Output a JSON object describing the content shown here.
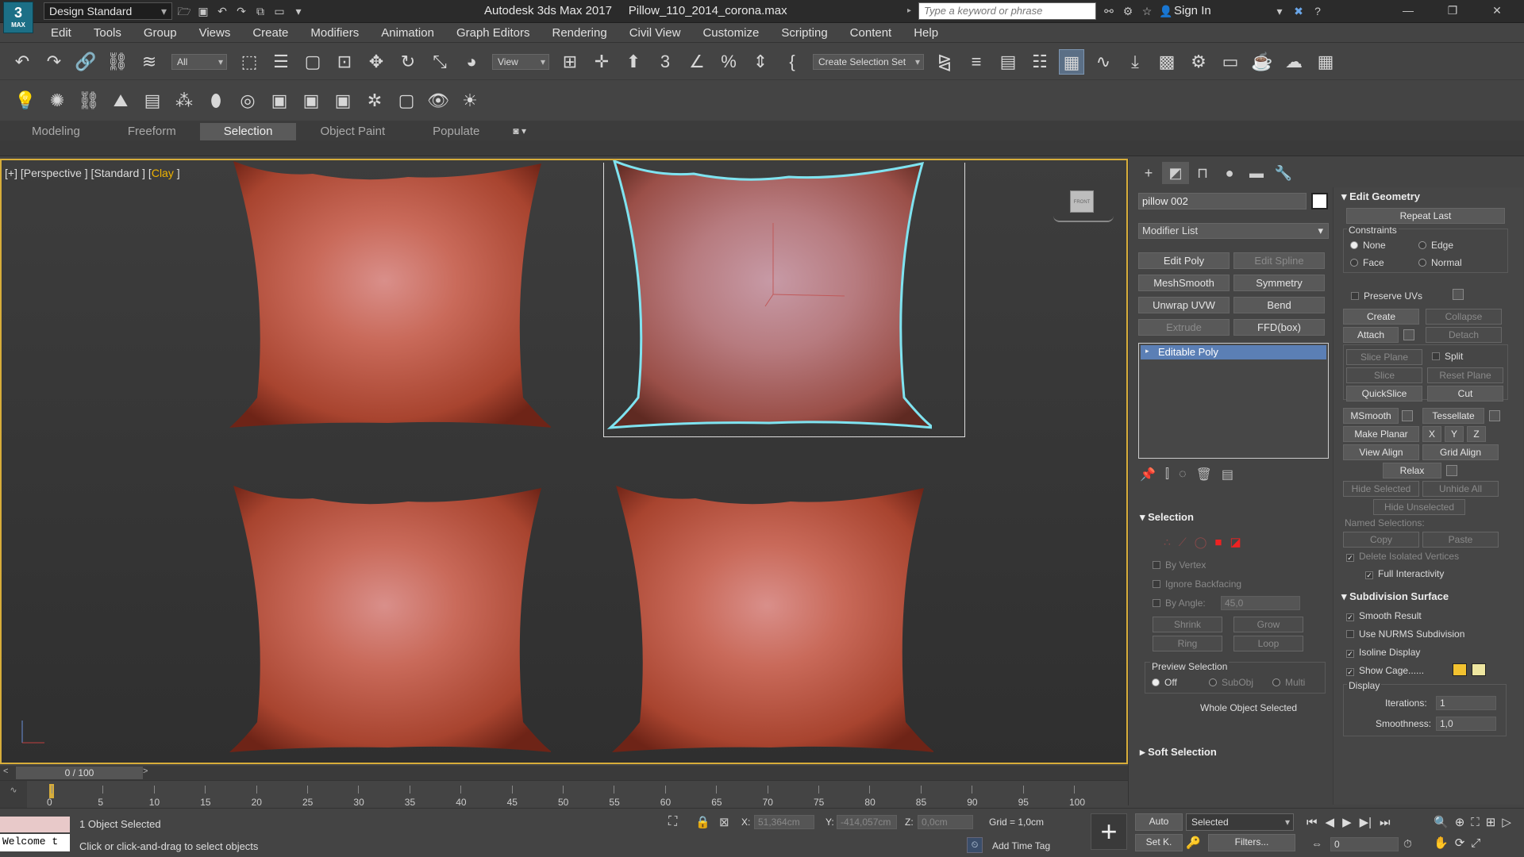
{
  "app": {
    "logo_text": "3",
    "logo_sub": "MAX",
    "workspace": "Design Standard",
    "title": "Autodesk 3ds Max 2017     Pillow_110_2014_corona.max",
    "search_placeholder": "Type a keyword or phrase",
    "sign_in": "Sign In"
  },
  "menu": [
    "Edit",
    "Tools",
    "Group",
    "Views",
    "Create",
    "Modifiers",
    "Animation",
    "Graph Editors",
    "Rendering",
    "Civil View",
    "Customize",
    "Scripting",
    "Content",
    "Help"
  ],
  "toolbar": {
    "filter": "All",
    "view": "View",
    "selection_set": "Create Selection Set"
  },
  "ribbon_tabs": [
    {
      "label": "Modeling",
      "active": false
    },
    {
      "label": "Freeform",
      "active": false
    },
    {
      "label": "Selection",
      "active": true
    },
    {
      "label": "Object Paint",
      "active": false
    },
    {
      "label": "Populate",
      "active": false
    }
  ],
  "viewport": {
    "label_prefix": "[+] [Perspective ] [Standard ] [",
    "label_shading": "Clay",
    "label_suffix": " ]",
    "viewcube": "FRONT",
    "pillow_color": "#c75a46",
    "selection_color": "#7fe3f0",
    "border_color": "#d7ad3a"
  },
  "panel": {
    "object_name": "pillow 002",
    "modifier_list": "Modifier List",
    "modifier_buttons": [
      {
        "label": "Edit Poly",
        "enabled": true
      },
      {
        "label": "Edit Spline",
        "enabled": false
      },
      {
        "label": "MeshSmooth",
        "enabled": true
      },
      {
        "label": "Symmetry",
        "enabled": true
      },
      {
        "label": "Unwrap UVW",
        "enabled": true
      },
      {
        "label": "Bend",
        "enabled": true
      },
      {
        "label": "Extrude",
        "enabled": false
      },
      {
        "label": "FFD(box)",
        "enabled": true
      }
    ],
    "stack_item": "Editable Poly",
    "selection": {
      "title": "Selection",
      "by_vertex": "By Vertex",
      "ignore_backfacing": "Ignore Backfacing",
      "by_angle": "By Angle:",
      "angle": "45,0",
      "shrink": "Shrink",
      "grow": "Grow",
      "ring": "Ring",
      "loop": "Loop",
      "preview_title": "Preview Selection",
      "preview_options": [
        "Off",
        "SubObj",
        "Multi"
      ],
      "whole_object": "Whole Object Selected"
    },
    "soft_selection": "Soft Selection",
    "edit_geometry": {
      "title": "Edit Geometry",
      "repeat_last": "Repeat Last",
      "constraints": "Constraints",
      "constraint_options": [
        "None",
        "Edge",
        "Face",
        "Normal"
      ],
      "preserve_uvs": "Preserve UVs",
      "create": "Create",
      "collapse": "Collapse",
      "attach": "Attach",
      "detach": "Detach",
      "slice_plane": "Slice Plane",
      "split": "Split",
      "slice": "Slice",
      "reset_plane": "Reset Plane",
      "quickslice": "QuickSlice",
      "cut": "Cut",
      "msmooth": "MSmooth",
      "tessellate": "Tessellate",
      "make_planar": "Make Planar",
      "x": "X",
      "y": "Y",
      "z": "Z",
      "view_align": "View Align",
      "grid_align": "Grid Align",
      "relax": "Relax",
      "hide_selected": "Hide Selected",
      "unhide_all": "Unhide All",
      "hide_unselected": "Hide Unselected",
      "named_selections": "Named Selections:",
      "copy": "Copy",
      "paste": "Paste",
      "delete_isolated": "Delete Isolated Vertices",
      "full_interactivity": "Full Interactivity"
    },
    "subdivision": {
      "title": "Subdivision Surface",
      "smooth_result": "Smooth Result",
      "use_nurms": "Use NURMS Subdivision",
      "isoline": "Isoline Display",
      "show_cage": "Show Cage......",
      "cage_color_1": "#f2c230",
      "cage_color_2": "#eee6a0",
      "display": "Display",
      "iterations_label": "Iterations:",
      "iterations": "1",
      "smoothness_label": "Smoothness:",
      "smoothness": "1,0"
    }
  },
  "timeline": {
    "slider": "0 / 100",
    "ticks": [
      "0",
      "5",
      "10",
      "15",
      "20",
      "25",
      "30",
      "35",
      "40",
      "45",
      "50",
      "55",
      "60",
      "65",
      "70",
      "75",
      "80",
      "85",
      "90",
      "95",
      "100"
    ]
  },
  "status": {
    "welcome": "Welcome t",
    "selected": "1 Object Selected",
    "prompt": "Click or click-and-drag to select objects",
    "x_label": "X:",
    "x": "51,364cm",
    "y_label": "Y:",
    "y": "-414,057cm",
    "z_label": "Z:",
    "z": "0,0cm",
    "grid": "Grid = 1,0cm",
    "add_time_tag": "Add Time Tag",
    "auto": "Auto",
    "selected_dd": "Selected",
    "set_key": "Set K.",
    "filters": "Filters...",
    "frame": "0"
  }
}
